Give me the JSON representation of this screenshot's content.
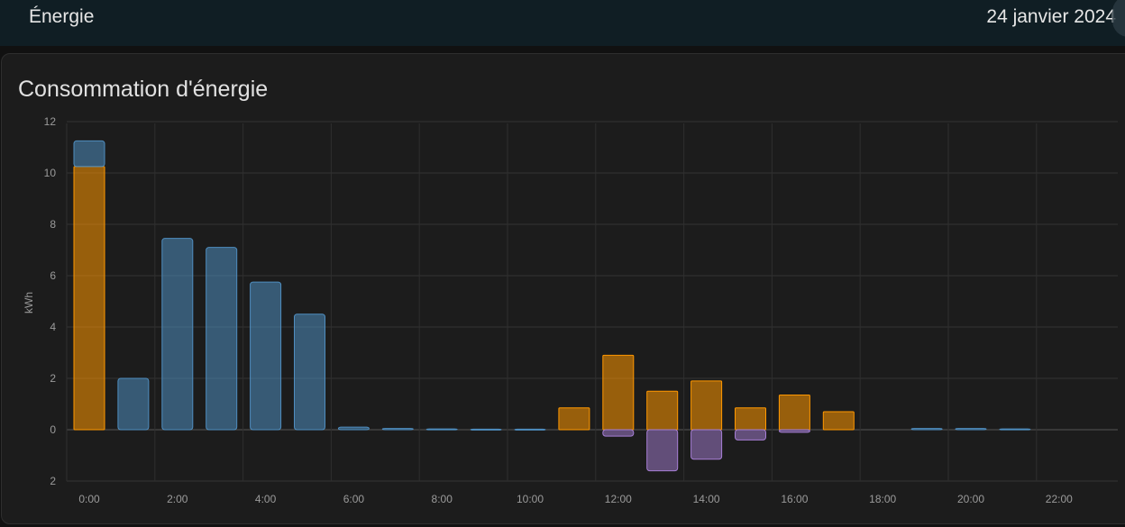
{
  "header": {
    "title": "Énergie",
    "date": "24 janvier 2024"
  },
  "card": {
    "title": "Consommation d'énergie"
  },
  "chart_data": {
    "type": "bar",
    "title": "Consommation d'énergie",
    "ylabel": "kWh",
    "xlabel": "",
    "ylim": [
      -2,
      12
    ],
    "y_ticks": [
      12,
      10,
      8,
      6,
      4,
      2,
      0,
      2
    ],
    "x_tick_labels": [
      "0:00",
      "2:00",
      "4:00",
      "6:00",
      "8:00",
      "10:00",
      "12:00",
      "14:00",
      "16:00",
      "18:00",
      "20:00",
      "22:00"
    ],
    "categories": [
      "0:00",
      "1:00",
      "2:00",
      "3:00",
      "4:00",
      "5:00",
      "6:00",
      "7:00",
      "8:00",
      "9:00",
      "10:00",
      "11:00",
      "12:00",
      "13:00",
      "14:00",
      "15:00",
      "16:00",
      "17:00",
      "18:00",
      "19:00",
      "20:00",
      "21:00",
      "22:00",
      "23:00"
    ],
    "grid": true,
    "colors": {
      "grid_consumption": "#4f8ec0",
      "solar": "#ff9800",
      "return_to_grid": "#a77fd6"
    },
    "series": [
      {
        "key": "solar",
        "stack": "positive",
        "values": [
          10.25,
          0,
          0,
          0,
          0,
          0,
          0,
          0,
          0,
          0,
          0,
          0.85,
          2.9,
          1.5,
          1.9,
          0.85,
          1.35,
          0.7,
          0,
          0,
          0,
          0,
          0,
          0
        ]
      },
      {
        "key": "grid_consumption",
        "stack": "positive",
        "values": [
          1.0,
          2.0,
          7.45,
          7.1,
          5.75,
          4.5,
          0.1,
          0.05,
          0.03,
          0.02,
          0.02,
          0,
          0,
          0,
          0,
          0,
          0,
          0,
          0,
          0.05,
          0.05,
          0.03,
          0,
          0
        ]
      },
      {
        "key": "return_to_grid",
        "stack": "negative",
        "values": [
          0,
          0,
          0,
          0,
          0,
          0,
          0,
          0,
          0,
          0,
          0,
          0,
          -0.25,
          -1.6,
          -1.15,
          -0.4,
          -0.1,
          0,
          0,
          0,
          0,
          0,
          0,
          0
        ]
      }
    ]
  }
}
